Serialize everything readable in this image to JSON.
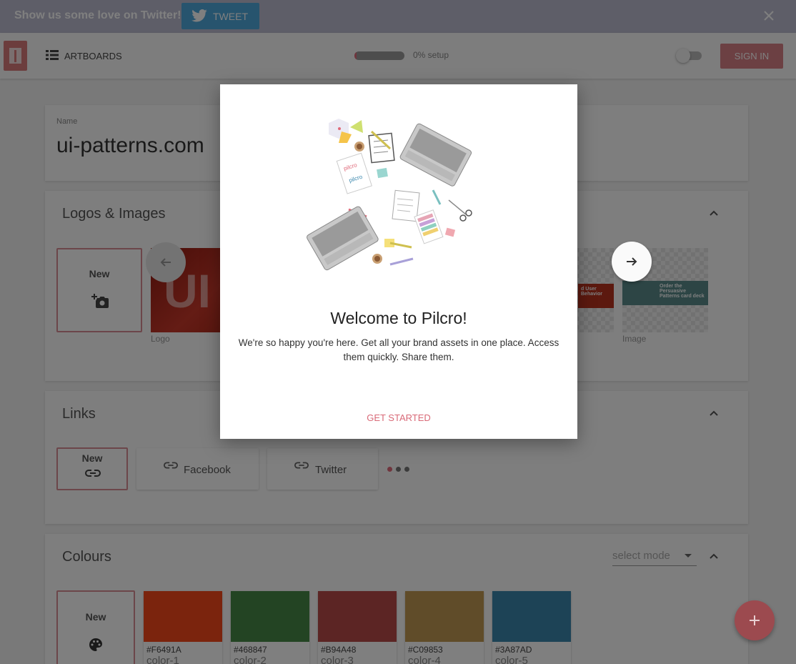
{
  "banner": {
    "text": "Show us some love on Twitter!",
    "tweet_label": "TWEET",
    "icons": {
      "tweet": "twitter-bird-icon",
      "close": "close-icon"
    }
  },
  "topbar": {
    "artboards_label": "ARTBOARDS",
    "artboards_icon": "list-icon",
    "progress_label": "0% setup",
    "progress_percent": 0,
    "dark_mode_on": false,
    "signin_label": "SIGN IN"
  },
  "name_section": {
    "label": "Name",
    "value": "ui-patterns.com"
  },
  "logos_section": {
    "title": "Logos & Images",
    "new_label": "New",
    "items": [
      {
        "caption": "Logo",
        "text": "UI"
      },
      {
        "caption": "",
        "text": "d User Behavior"
      },
      {
        "caption": "Image",
        "text": "Order the Persuasive Patterns card deck"
      }
    ]
  },
  "links_section": {
    "title": "Links",
    "new_label": "New",
    "items": [
      {
        "label": "Facebook"
      },
      {
        "label": "Twitter"
      }
    ],
    "page_dots": 3,
    "active_dot": 0
  },
  "colours_section": {
    "title": "Colours",
    "select_placeholder": "select mode",
    "new_label": "New",
    "swatches": [
      {
        "hex": "#F6491A",
        "name": "color-1"
      },
      {
        "hex": "#468847",
        "name": "color-2"
      },
      {
        "hex": "#B94A48",
        "name": "color-3"
      },
      {
        "hex": "#C09853",
        "name": "color-4"
      },
      {
        "hex": "#3A87AD",
        "name": "color-5"
      }
    ]
  },
  "modal": {
    "title": "Welcome to Pilcro!",
    "body": "We're so happy you're here. Get all your brand assets in one place. Access them quickly. Share them.",
    "action_label": "GET STARTED",
    "illustration_text_1": "pilcro",
    "illustration_text_2": "pilcro"
  },
  "colors": {
    "accent": "#d98087",
    "overlay": "#000000"
  }
}
